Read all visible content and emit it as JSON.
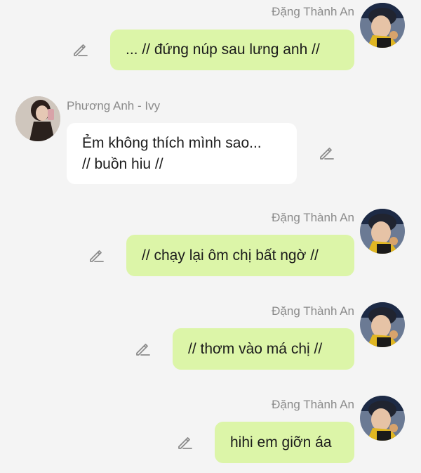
{
  "messages": [
    {
      "sender": "Đặng Thành An",
      "side": "right",
      "lines": [
        "... // đứng núp sau lưng anh //"
      ]
    },
    {
      "sender": "Phương Anh - Ivy",
      "side": "left",
      "lines": [
        "Ẻm không thích mình sao...",
        "// buồn hiu //"
      ]
    },
    {
      "sender": "Đặng Thành An",
      "side": "right",
      "lines": [
        "// chạy lại ôm chị bất ngờ //"
      ]
    },
    {
      "sender": "Đặng Thành An",
      "side": "right",
      "lines": [
        "// thơm vào má chị //"
      ]
    },
    {
      "sender": "Đặng Thành An",
      "side": "right",
      "lines": [
        "hihi em giỡn áa"
      ]
    }
  ],
  "icons": {
    "edit": "pencil-edit-icon"
  },
  "colors": {
    "background": "#f4f4f4",
    "my_bubble": "#dcf5a8",
    "their_bubble": "#ffffff",
    "sender_name": "#8a8a8a",
    "edit_icon": "#8c8c8c"
  }
}
